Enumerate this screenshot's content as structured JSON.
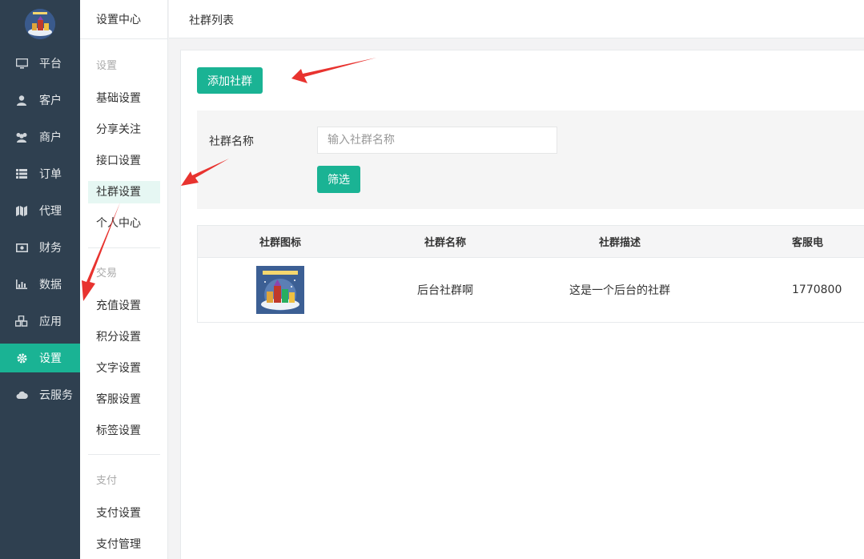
{
  "nav": {
    "items": [
      {
        "label": "平台",
        "icon": "monitor-icon"
      },
      {
        "label": "客户",
        "icon": "user-icon"
      },
      {
        "label": "商户",
        "icon": "users-icon"
      },
      {
        "label": "订单",
        "icon": "list-icon"
      },
      {
        "label": "代理",
        "icon": "map-icon"
      },
      {
        "label": "财务",
        "icon": "money-icon"
      },
      {
        "label": "数据",
        "icon": "bar-chart-icon"
      },
      {
        "label": "应用",
        "icon": "cubes-icon"
      },
      {
        "label": "设置",
        "icon": "gear-icon",
        "active": true
      },
      {
        "label": "云服务",
        "icon": "cloud-icon"
      }
    ]
  },
  "sidebar": {
    "title": "设置中心",
    "groups": [
      {
        "label": "设置",
        "items": [
          "基础设置",
          "分享关注",
          "接口设置",
          "社群设置",
          "个人中心"
        ]
      },
      {
        "label": "交易",
        "items": [
          "充值设置",
          "积分设置",
          "文字设置",
          "客服设置",
          "标签设置"
        ]
      },
      {
        "label": "支付",
        "items": [
          "支付设置",
          "支付管理"
        ]
      }
    ],
    "active_item": "社群设置"
  },
  "header": {
    "breadcrumb": "社群列表"
  },
  "main": {
    "add_button": "添加社群",
    "filter": {
      "label": "社群名称",
      "placeholder": "输入社群名称",
      "value": "",
      "button": "筛选"
    },
    "table": {
      "columns": [
        "社群图标",
        "社群名称",
        "社群描述",
        "客服电"
      ],
      "rows": [
        {
          "name": "后台社群啊",
          "description": "这是一个后台的社群",
          "phone": "1770800"
        }
      ]
    }
  },
  "colors": {
    "accent": "#1ab394",
    "nav_bg": "#2f4050",
    "arrow": "#e8332f"
  }
}
